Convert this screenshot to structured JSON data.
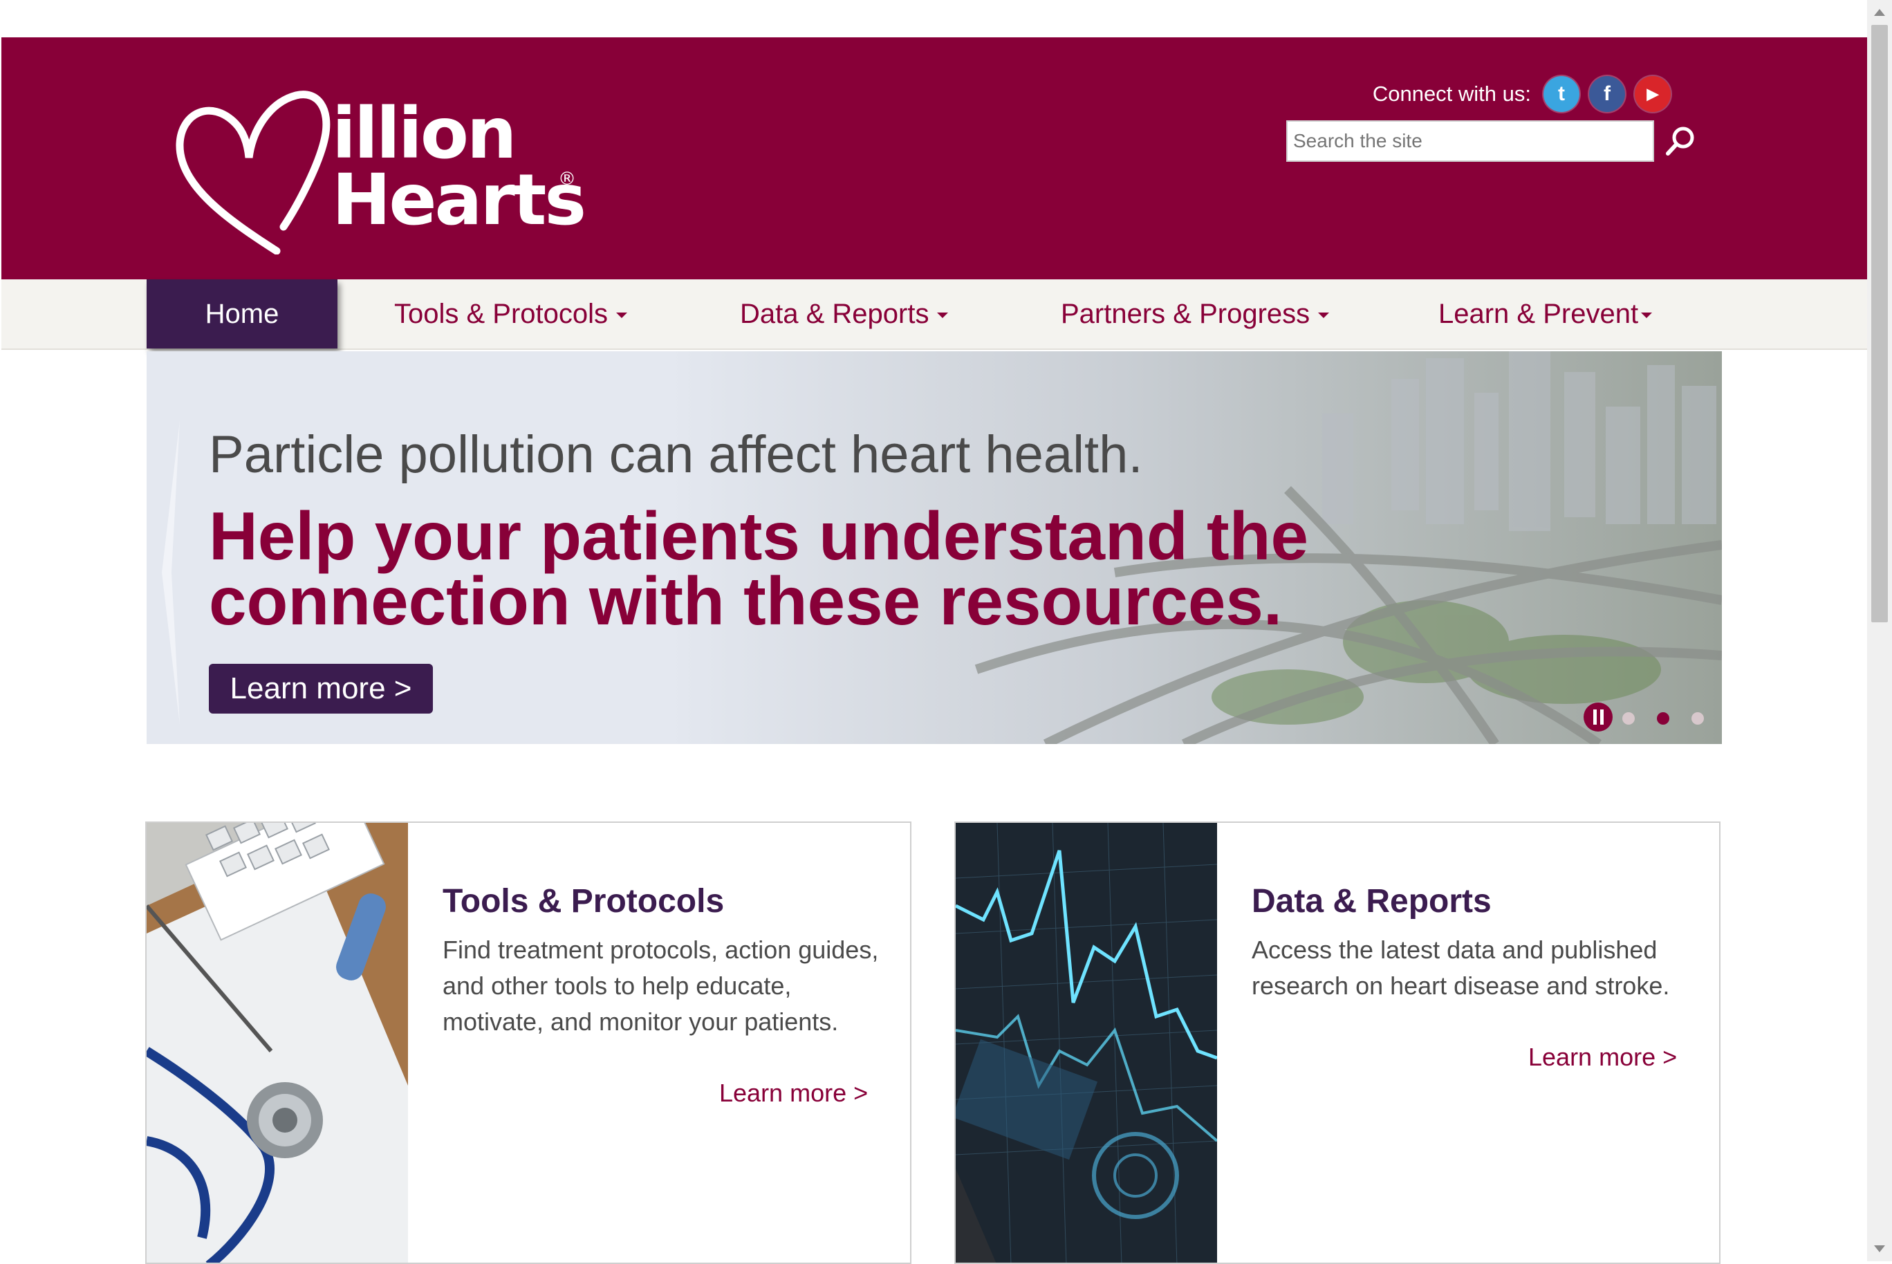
{
  "brand": {
    "logo_line1": "illion",
    "logo_line2": "Hearts",
    "logo_reg": "®",
    "primary_color": "#880038",
    "nav_active_color": "#3b1c4f"
  },
  "header": {
    "connect_label": "Connect with us:",
    "social": [
      {
        "icon": "twitter-icon",
        "glyph": "t"
      },
      {
        "icon": "facebook-icon",
        "glyph": "f"
      },
      {
        "icon": "youtube-icon",
        "glyph": "▶"
      }
    ],
    "search_placeholder": "Search the site"
  },
  "nav": {
    "items": [
      {
        "label": "Home",
        "active": true
      },
      {
        "label": "Tools & Protocols"
      },
      {
        "label": "Data & Reports"
      },
      {
        "label": "Partners & Progress"
      },
      {
        "label": "Learn & Prevent"
      }
    ]
  },
  "hero": {
    "subtitle": "Particle pollution can affect heart health.",
    "title": "Help your patients understand the connection with these resources.",
    "button": "Learn more >"
  },
  "cards": [
    {
      "title": "Tools & Protocols",
      "text": "Find treatment protocols, action guides, and other tools to help educate, motivate, and monitor your patients.",
      "link": "Learn more >"
    },
    {
      "title": "Data & Reports",
      "text": "Access the latest data and published research on heart disease and stroke.",
      "link": "Learn more >"
    }
  ]
}
